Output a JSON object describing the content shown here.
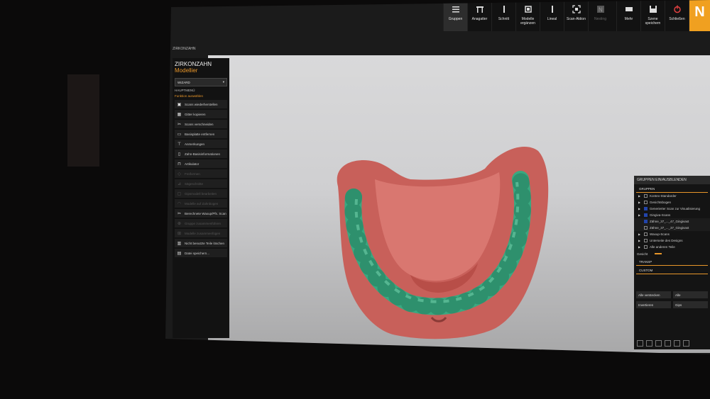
{
  "window_title": "ZIRKONZAHN",
  "brand": {
    "name": "ZIRKONZAHN",
    "product": "Modellier"
  },
  "toolbar": {
    "tools": [
      {
        "label": "Gruppen",
        "icon": "menu-icon",
        "active": true
      },
      {
        "label": "Anagatter",
        "icon": "articulator-icon"
      },
      {
        "label": "Schnitt",
        "icon": "cut-icon"
      },
      {
        "label": "Modelle ergänzen",
        "icon": "model-icon"
      },
      {
        "label": "Lineal",
        "icon": "ruler-icon"
      },
      {
        "label": "Scan-Aktion",
        "icon": "scan-icon"
      },
      {
        "label": "Nesting",
        "icon": "nesting-icon",
        "disabled": true
      }
    ],
    "right_tools": [
      {
        "label": "Mehr",
        "icon": "more-icon"
      },
      {
        "label": "Szene speichern",
        "icon": "save-icon"
      },
      {
        "label": "Schließen",
        "icon": "power-icon"
      }
    ],
    "logo": "N"
  },
  "left_panel": {
    "dropdown": "WIZARD",
    "section": "HAUPTMENÜ",
    "subsection": "Funktion auswählen",
    "items": [
      {
        "label": "Scans wiederherstellen",
        "icon": "scan-icon"
      },
      {
        "label": "Gitter kopieren",
        "icon": "grid-icon"
      },
      {
        "label": "Scans verschneiden",
        "icon": "scissors-icon"
      },
      {
        "label": "Basisplatte entfernen",
        "icon": "base-icon"
      },
      {
        "label": "Anmerkungen",
        "icon": "pin-icon"
      },
      {
        "label": "Zahn-Basisinformationen",
        "icon": "tooth-icon"
      },
      {
        "label": "Artikulator",
        "icon": "articulator-icon"
      },
      {
        "label": "Freiformen",
        "icon": "freeform-icon",
        "disabled": true
      },
      {
        "label": "Sägeschnitte",
        "icon": "saw-icon",
        "disabled": true
      },
      {
        "label": "Gipsmodell bearbeiten",
        "icon": "model-icon",
        "disabled": true
      },
      {
        "label": "Modelle auf Zahnbogen",
        "icon": "arch-icon",
        "disabled": true
      },
      {
        "label": "Berechnete Waxup/Pfs. Scan",
        "icon": "scissors-icon"
      },
      {
        "label": "Gruppe zusammenführen",
        "icon": "merge-icon",
        "disabled": true
      },
      {
        "label": "Modelle zusammenfügen",
        "icon": "join-icon",
        "disabled": true
      },
      {
        "label": "Nicht benutzte Teile löschen",
        "icon": "trash-icon"
      },
      {
        "label": "Datei speichern...",
        "icon": "save-icon"
      }
    ]
  },
  "right_panel": {
    "title": "GRUPPEN EIN/AUSBLENDEN",
    "groups_label": "GRUPPEN",
    "groups": [
      {
        "label": "Kontex-Standarder",
        "checked": false
      },
      {
        "label": "Gesichtsbogen",
        "checked": false
      },
      {
        "label": "Generierter Scan zur Visualisierung",
        "checked": true
      },
      {
        "label": "Gingiva-Scans",
        "checked": true
      },
      {
        "label": "Zähne_37_..._47_Gingivast",
        "checked": true,
        "sub": true
      },
      {
        "label": "Zähne_37_..._37_Gingivast",
        "checked": false,
        "sub": true
      },
      {
        "label": "Waxup-Scans",
        "checked": false
      },
      {
        "label": "Unterseite des Designs",
        "checked": false
      },
      {
        "label": "Alle anderen Teile",
        "checked": false
      }
    ],
    "gesicht": "Gesicht",
    "sections": [
      "TRANSP",
      "CUSTOM"
    ],
    "buttons": [
      [
        "Alle verstecken",
        "Alle"
      ],
      [
        "Invertieren",
        "Gips"
      ]
    ]
  },
  "colors": {
    "accent": "#e8962a",
    "gum": "#c8605a",
    "teeth": "#3aa880"
  }
}
